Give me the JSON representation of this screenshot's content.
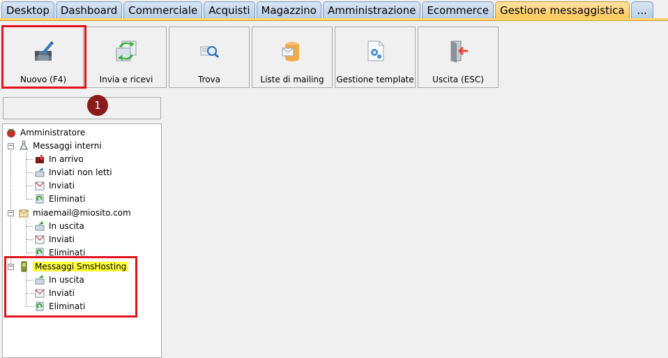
{
  "tabs": [
    "Desktop",
    "Dashboard",
    "Commerciale",
    "Acquisti",
    "Magazzino",
    "Amministrazione",
    "Ecommerce",
    "Gestione messaggistica",
    "..."
  ],
  "toolbar": {
    "new": "Nuovo (F4)",
    "send_receive": "Invia e ricevi",
    "find": "Trova",
    "mailing_lists": "Liste di mailing",
    "templates": "Gestione template",
    "exit": "Uscita (ESC)"
  },
  "badge": "1",
  "tree": {
    "root": "Amministratore",
    "internal": {
      "label": "Messaggi interni",
      "children": [
        "In arrivo",
        "Inviati non letti",
        "Inviati",
        "Eliminati"
      ]
    },
    "email": {
      "label": "miaemail@miosito.com",
      "children": [
        "In uscita",
        "Inviati",
        "Eliminati"
      ]
    },
    "sms": {
      "label": "Messaggi SmsHosting",
      "children": [
        "In uscita",
        "Inviati",
        "Eliminati"
      ]
    }
  },
  "colors": {
    "highlight_red": "#e0121c",
    "active_tab": "#ffc85c",
    "badge": "#8b1a1a",
    "sms_highlight": "#ffff3a"
  }
}
